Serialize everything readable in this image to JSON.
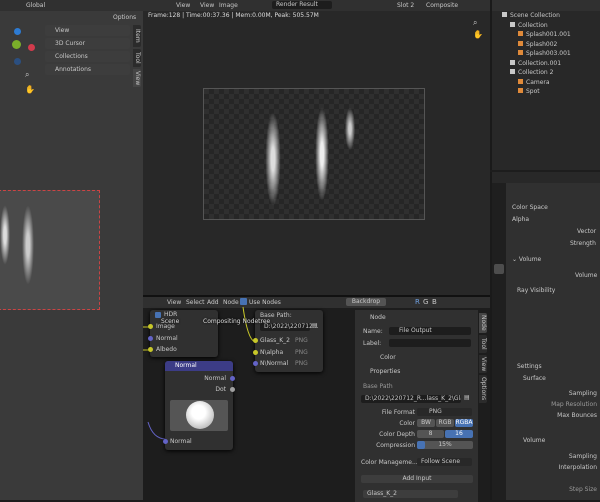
{
  "viewport": {
    "orientation": "Global",
    "options": "Options",
    "panels": [
      "View",
      "3D Cursor",
      "Collections",
      "Annotations"
    ],
    "tabs": [
      "Item",
      "Tool",
      "View"
    ]
  },
  "image_editor": {
    "menus": [
      "View",
      "View",
      "Image"
    ],
    "image_name": "Render Result",
    "slot": "Slot 2",
    "layer": "Composite",
    "status": "Frame:128 | Time:00:37.36 | Mem:0.00M, Peak: 505.57M"
  },
  "outliner": {
    "items": [
      {
        "label": "Scene Collection",
        "indent": 0,
        "color": "#c8c8c8"
      },
      {
        "label": "Collection",
        "indent": 1,
        "color": "#c8c8c8"
      },
      {
        "label": "Splash001.001",
        "indent": 2,
        "color": "#e08a3a"
      },
      {
        "label": "Splash002",
        "indent": 2,
        "color": "#e08a3a"
      },
      {
        "label": "Splash003.001",
        "indent": 2,
        "color": "#e08a3a"
      },
      {
        "label": "Collection.001",
        "indent": 1,
        "color": "#c8c8c8"
      },
      {
        "label": "Collection 2",
        "indent": 1,
        "color": "#c8c8c8"
      },
      {
        "label": "Camera",
        "indent": 2,
        "color": "#e08a3a"
      },
      {
        "label": "Spot",
        "indent": 2,
        "color": "#e08a3a"
      }
    ]
  },
  "properties": {
    "rows": {
      "color_space": "Color Space",
      "alpha": "Alpha",
      "vector": "Vector",
      "strength": "Strength",
      "volume_hdr": "Volume",
      "volume": "Volume",
      "ray_visibility": "Ray Visibility",
      "settings": "Settings",
      "surface": "Surface",
      "sampling": "Sampling",
      "map_resolution": "Map Resolution",
      "max_bounces": "Max Bounces",
      "volume2": "Volume",
      "sampling2": "Sampling",
      "interpolation": "Interpolation",
      "step_size": "Step Size"
    }
  },
  "node_editor": {
    "menus": [
      "View",
      "Select",
      "Add",
      "Node"
    ],
    "use_nodes": "Use Nodes",
    "backdrop": "Backdrop",
    "channels": [
      "R",
      "G",
      "B"
    ],
    "breadcrumb": [
      "Scene",
      "Compositing Nodetree"
    ],
    "render_node": {
      "hdr": "HDR",
      "outputs": [
        "Image",
        "Normal",
        "Albedo"
      ]
    },
    "normal_node": {
      "title": "Normal",
      "outputs": [
        "Normal",
        "Dot"
      ],
      "input": "Normal"
    },
    "file_output_node": {
      "base_path_label": "Base Path:",
      "base_path": "D:\\2022\\220712...",
      "inputs": [
        {
          "name": "Glass_K_2",
          "fmt": "PNG"
        },
        {
          "name": "N\\alpha",
          "fmt": "PNG"
        },
        {
          "name": "N\\Normal",
          "fmt": "PNG"
        }
      ]
    },
    "sidebar": {
      "node_header": "Node",
      "name_label": "Name:",
      "name": "File Output",
      "label_label": "Label:",
      "color": "Color",
      "properties": "Properties",
      "base_path_label": "Base Path",
      "base_path": "D:\\2022\\220712_R...lass_K_2\\Glass_K_2",
      "file_format_label": "File Format",
      "file_format": "PNG",
      "color_label": "Color",
      "color_modes": [
        "BW",
        "RGB",
        "RGBA"
      ],
      "color_depth_label": "Color Depth",
      "depths": [
        "8",
        "16"
      ],
      "compression_label": "Compression",
      "compression": "15%",
      "compression_value": 15,
      "color_mgmt_label": "Color Manageme...",
      "color_mgmt": "Follow Scene",
      "add_input": "Add Input",
      "input_item": "Glass_K_2"
    },
    "tabs": [
      "Node",
      "Tool",
      "View",
      "Options"
    ]
  }
}
